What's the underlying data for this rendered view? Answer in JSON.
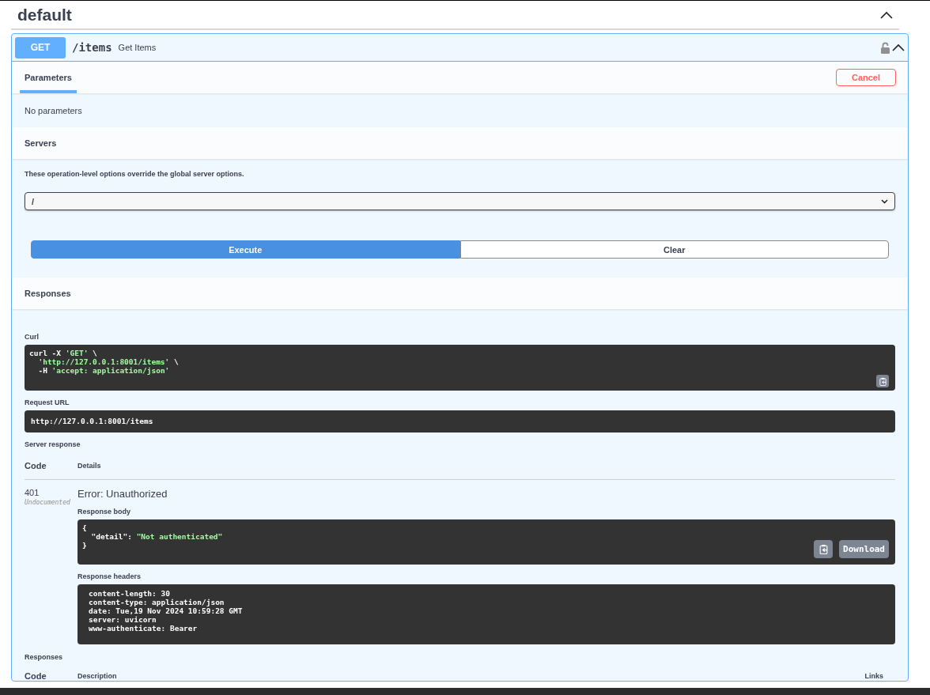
{
  "section": {
    "title": "default",
    "expanded": true
  },
  "operation": {
    "method": "GET",
    "path": "/items",
    "summary": "Get Items",
    "locked": false,
    "expanded": true
  },
  "tabs": [
    {
      "label": "Parameters",
      "selected": true
    }
  ],
  "cancel_button": "Cancel",
  "parameters_note": "No parameters",
  "servers": {
    "heading": "Servers",
    "description": "These operation-level options override the global server options.",
    "select_value": "/"
  },
  "actions": [
    {
      "label": "Execute",
      "kind": "primary"
    },
    {
      "label": "Clear",
      "kind": "secondary"
    }
  ],
  "responses_heading": "Responses",
  "curl": {
    "label": "Curl",
    "lines": [
      [
        {
          "text": "curl -X ",
          "kind": "plain"
        },
        {
          "text": "'GET'",
          "kind": "string"
        },
        {
          "text": " \\",
          "kind": "plain"
        }
      ],
      [
        {
          "text": "  'http://127.0.0.1:8001/items'",
          "kind": "string"
        },
        {
          "text": " \\",
          "kind": "plain"
        }
      ],
      [
        {
          "text": "  -H ",
          "kind": "plain"
        },
        {
          "text": "'accept: application/json'",
          "kind": "string"
        }
      ]
    ]
  },
  "request_url": {
    "label": "Request URL",
    "value": "http://127.0.0.1:8001/items"
  },
  "server_response": {
    "label": "Server response",
    "columns": [
      "Code",
      "Details"
    ],
    "code": "401",
    "code_note": "Undocumented",
    "error": "Error: Unauthorized",
    "body_label": "Response body",
    "body_lines": [
      [
        {
          "text": "{",
          "kind": "plain"
        }
      ],
      [
        {
          "text": "  \"detail\": ",
          "kind": "plain"
        },
        {
          "text": "\"Not authenticated\"",
          "kind": "string"
        }
      ],
      [
        {
          "text": "}",
          "kind": "plain"
        }
      ]
    ],
    "download_button": "Download",
    "headers_label": "Response headers",
    "headers": [
      "content-length: 30",
      "content-type: application/json",
      "date: Tue,19 Nov 2024 10:59:28 GMT",
      "server: uvicorn",
      "www-authenticate: Bearer"
    ]
  },
  "responses": {
    "label": "Responses",
    "columns": [
      "Code",
      "Description",
      "Links"
    ]
  }
}
